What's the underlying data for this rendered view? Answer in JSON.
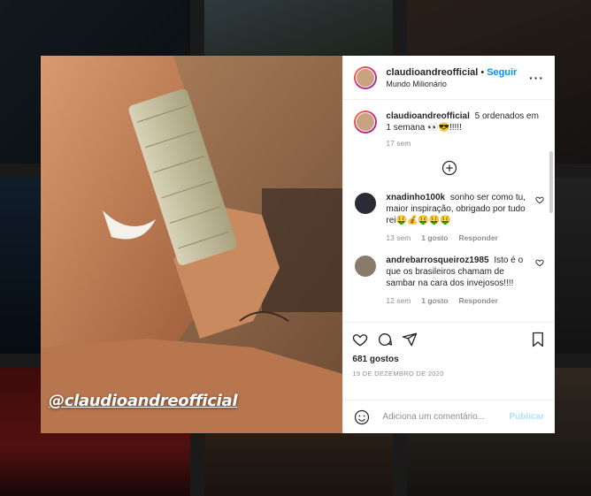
{
  "post": {
    "username": "claudioandreofficial",
    "separator": "•",
    "follow_label": "Seguir",
    "location": "Mundo Milionário",
    "more_icon": "more-horizontal-icon",
    "photo_caption": "@claudioandreofficial"
  },
  "caption": {
    "username": "claudioandreofficial",
    "text": "5 ordenados em 1 semana 👀😎!!!!!",
    "time": "17 sem"
  },
  "load_more_icon": "plus-circle-icon",
  "comments": [
    {
      "username": "xnadinho100k",
      "text": "sonho ser como tu, maior inspiração, obrigado por tudo rei🤑💰🤑🤑🤑",
      "time": "13 sem",
      "likes": "1 gosto",
      "reply": "Responder"
    },
    {
      "username": "andrebarrosqueiroz1985",
      "text": "Isto é o que os brasileiros chamam de sambar na cara dos invejosos!!!!",
      "time": "12 sem",
      "likes": "1 gosto",
      "reply": "Responder"
    }
  ],
  "actions": {
    "likes_count": "681 gostos",
    "date": "19 DE DEZEMBRO DE 2020"
  },
  "add_comment": {
    "placeholder": "Adiciona um comentário...",
    "publish_label": "Publicar"
  },
  "colors": {
    "accent": "#0095f6",
    "publish_disabled": "#b2dffc",
    "text": "#262626",
    "muted": "#8e8e8e"
  }
}
